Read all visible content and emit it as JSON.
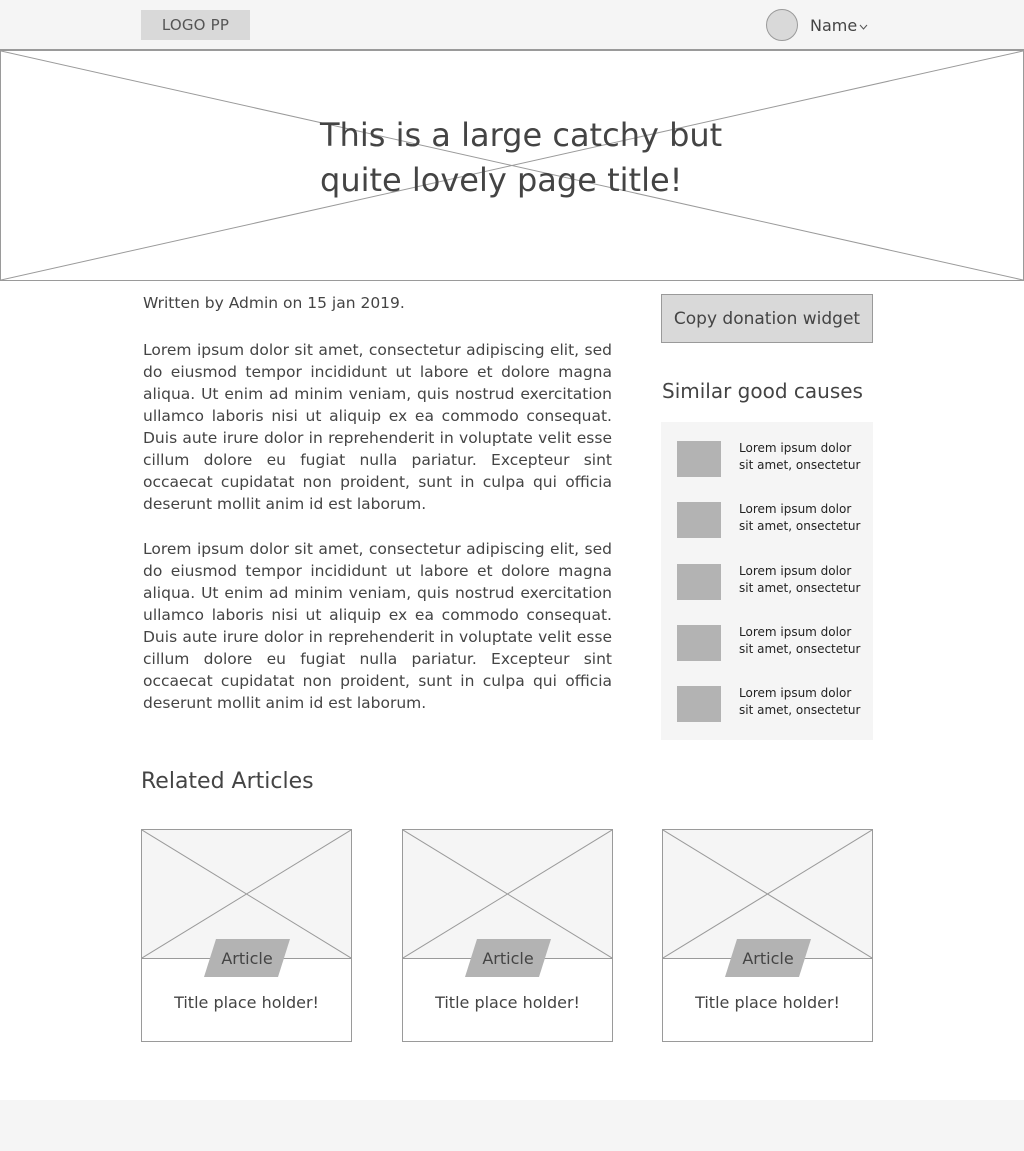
{
  "header": {
    "logo": "LOGO PP",
    "user_name": "Name"
  },
  "hero": {
    "title": "This is a large catchy but quite lovely page title!"
  },
  "article": {
    "meta": "Written by Admin on 15 jan 2019.",
    "paragraphs": [
      "Lorem ipsum dolor sit amet, consectetur adipiscing elit, sed do eiusmod tempor incididunt ut labore et dolore magna aliqua. Ut enim ad minim veniam, quis nostrud exercitation ullamco laboris nisi ut aliquip ex ea commodo consequat. Duis aute irure dolor in reprehenderit in voluptate velit esse cillum dolore eu fugiat nulla pariatur. Excepteur sint occaecat cupidatat non proident, sunt in culpa qui officia deserunt mollit anim id est laborum.",
      "Lorem ipsum dolor sit amet, consectetur adipiscing elit, sed do eiusmod tempor incididunt ut labore et dolore magna aliqua. Ut enim ad minim veniam, quis nostrud exercitation ullamco laboris nisi ut aliquip ex ea commodo consequat. Duis aute irure dolor in reprehenderit in voluptate velit esse cillum dolore eu fugiat nulla pariatur. Excepteur sint occaecat cupidatat non proident, sunt in culpa qui officia deserunt mollit anim id est laborum."
    ]
  },
  "sidebar": {
    "donate_label": "Copy donation widget",
    "causes_heading": "Similar good causes",
    "causes": [
      {
        "text": "Lorem ipsum dolor sit amet, onsectetur"
      },
      {
        "text": "Lorem ipsum dolor sit amet, onsectetur"
      },
      {
        "text": "Lorem ipsum dolor sit amet, onsectetur"
      },
      {
        "text": "Lorem ipsum dolor sit amet, onsectetur"
      },
      {
        "text": "Lorem ipsum dolor sit amet, onsectetur"
      }
    ]
  },
  "related": {
    "heading": "Related Articles",
    "cards": [
      {
        "tag": "Article",
        "title": "Title place holder!"
      },
      {
        "tag": "Article",
        "title": "Title place holder!"
      },
      {
        "tag": "Article",
        "title": "Title place holder!"
      }
    ]
  },
  "colors": {
    "panel_bg": "#f5f5f5",
    "placeholder_gray": "#d9d9d9",
    "thumb_gray": "#b3b3b3",
    "border": "#9a9a9a",
    "text": "#444444"
  }
}
